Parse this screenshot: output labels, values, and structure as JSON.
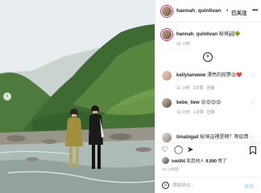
{
  "post": {
    "username": "hannah_quinlivan",
    "dot": "•",
    "follow_label": "已关注",
    "more_icon": "more-horizontal-icon"
  },
  "caption": {
    "username": "hannah_quinlivan",
    "text": "秘境🏞🌳",
    "time": "13 小时"
  },
  "comments": [
    {
      "username": "kellytanwww",
      "text": "漂亮的寂寥😍❤️",
      "time": "11 小时",
      "likes": "2次赞",
      "reply": "回复"
    },
    {
      "username": "bebe_liew",
      "text": "😍😍😍😍",
      "time": "12 小时",
      "likes": "1次赞",
      "reply": "回复"
    },
    {
      "username": "limabigail",
      "text": "秘境這裡是啊？等疫情",
      "time": "",
      "likes": "",
      "reply": ""
    }
  ],
  "actions": {
    "like_icon": "heart-icon",
    "comment_icon": "comment-icon",
    "share_icon": "paper-plane-icon",
    "save_icon": "bookmark-icon"
  },
  "likes": {
    "liker": "lok666",
    "text": "和其他人",
    "count": "9,990",
    "suffix": "赞了"
  },
  "timestamp": "12 小时前",
  "add_comment": {
    "placeholder": "添加评论...",
    "post_label": "发布"
  },
  "photo": {
    "colors": {
      "sky": "#e9eef0",
      "mountain": "#3e6b34",
      "mountain_light": "#6f9a4a",
      "water": "#b9c6c1",
      "rocks": "#8c857a",
      "coat_left": "#9a8a3a",
      "coat_right": "#1c1c1c"
    }
  }
}
